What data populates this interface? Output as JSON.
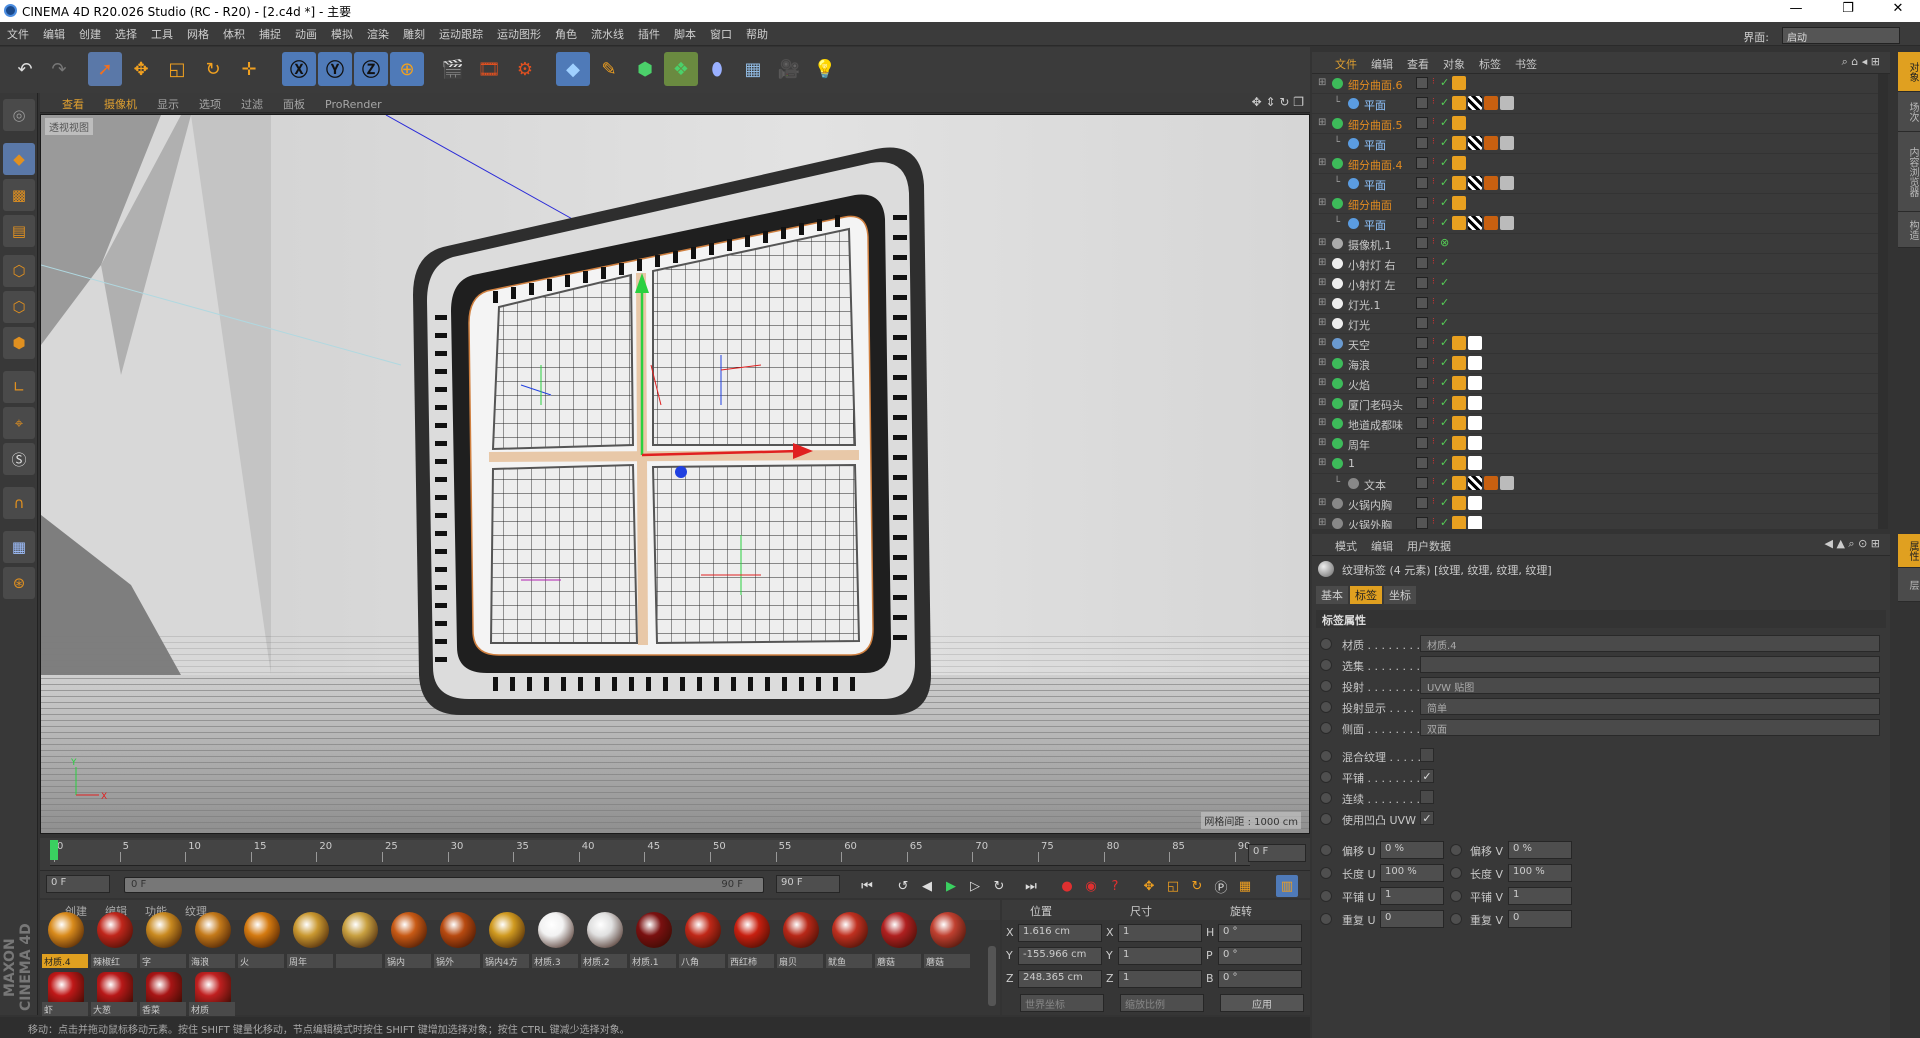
{
  "window": {
    "title": "CINEMA 4D R20.026 Studio (RC - R20) - [2.c4d *] - 主要"
  },
  "menu": [
    "文件",
    "编辑",
    "创建",
    "选择",
    "工具",
    "网格",
    "体积",
    "捕捉",
    "动画",
    "模拟",
    "渲染",
    "雕刻",
    "运动跟踪",
    "运动图形",
    "角色",
    "流水线",
    "插件",
    "脚本",
    "窗口",
    "帮助"
  ],
  "interface": {
    "label": "界面:",
    "value": "启动"
  },
  "viewport": {
    "menu": [
      "查看",
      "摄像机",
      "显示",
      "选项",
      "过滤",
      "面板",
      "ProRender"
    ],
    "name": "透视视图",
    "grid_spacing": "网格间距 : 1000 cm"
  },
  "timeline": {
    "ticks": [
      "0",
      "5",
      "10",
      "15",
      "20",
      "25",
      "30",
      "35",
      "40",
      "45",
      "50",
      "55",
      "60",
      "65",
      "70",
      "75",
      "80",
      "85",
      "90"
    ],
    "current_frame": "0 F",
    "start": "0 F",
    "range_start": "0 F",
    "range_end": "90 F",
    "end": "90 F"
  },
  "materials": {
    "menu": [
      "创建",
      "编辑",
      "功能",
      "纹理"
    ],
    "row1": [
      {
        "name": "材质.4",
        "color": "#d98b1c"
      },
      {
        "name": "辣椒红",
        "color": "#c0261b"
      },
      {
        "name": "字",
        "color": "#c98a20"
      },
      {
        "name": "海浪",
        "color": "#c47a1a"
      },
      {
        "name": "火",
        "color": "#d47a10"
      },
      {
        "name": "周年",
        "color": "#c99830"
      },
      {
        "name": "",
        "color": "#c8a040"
      },
      {
        "name": "锅内",
        "color": "#c85a15"
      },
      {
        "name": "锅外",
        "color": "#b84a10"
      },
      {
        "name": "锅内4方",
        "color": "#d09a20"
      },
      {
        "name": "材质.3",
        "color": "#f2f2f2"
      },
      {
        "name": "材质.2",
        "color": "#e0e0e0"
      },
      {
        "name": "材质.1",
        "color": "#7a1010"
      },
      {
        "name": "八角",
        "color": "#c02818"
      },
      {
        "name": "西红柿",
        "color": "#c82010"
      },
      {
        "name": "扇贝",
        "color": "#b82818"
      },
      {
        "name": "鱿鱼",
        "color": "#c03020"
      },
      {
        "name": "蘑菇",
        "color": "#b02020"
      },
      {
        "name": "蘑菇",
        "color": "#c04030"
      }
    ],
    "row2": [
      {
        "name": "虾",
        "color": "#c01818"
      },
      {
        "name": "大葱",
        "color": "#b81818"
      },
      {
        "name": "香菜",
        "color": "#a81515"
      },
      {
        "name": "材质",
        "color": "#c02020"
      }
    ]
  },
  "coords": {
    "headers": [
      "位置",
      "尺寸",
      "旋转"
    ],
    "rows": [
      {
        "axis": "X",
        "pos": "1.616 cm",
        "size_axis": "X",
        "size": "1",
        "rot_axis": "H",
        "rot": "0 °"
      },
      {
        "axis": "Y",
        "pos": "-155.966 cm",
        "size_axis": "Y",
        "size": "1",
        "rot_axis": "P",
        "rot": "0 °"
      },
      {
        "axis": "Z",
        "pos": "248.365 cm",
        "size_axis": "Z",
        "size": "1",
        "rot_axis": "B",
        "rot": "0 °"
      }
    ],
    "mode1": "世界坐标",
    "mode2": "缩放比例",
    "apply": "应用"
  },
  "status": "移动：点击并拖动鼠标移动元素。按住 SHIFT 键量化移动，节点编辑模式时按住 SHIFT 键增加选择对象；按住 CTRL 键减少选择对象。",
  "brand": "MAXON CINEMA 4D",
  "objects": {
    "menu": [
      "文件",
      "编辑",
      "查看",
      "对象",
      "标签",
      "书签"
    ],
    "rows": [
      {
        "name": "细分曲面.6",
        "indent": 1,
        "color": "#e08a20",
        "icon": "#3dbb5a"
      },
      {
        "name": "平面",
        "indent": 2,
        "color": "#8fc4ff",
        "icon": "#5b9ce0"
      },
      {
        "name": "细分曲面.5",
        "indent": 1,
        "color": "#e08a20",
        "icon": "#3dbb5a"
      },
      {
        "name": "平面",
        "indent": 2,
        "color": "#8fc4ff",
        "icon": "#5b9ce0"
      },
      {
        "name": "细分曲面.4",
        "indent": 1,
        "color": "#e08a20",
        "icon": "#3dbb5a"
      },
      {
        "name": "平面",
        "indent": 2,
        "color": "#8fc4ff",
        "icon": "#5b9ce0"
      },
      {
        "name": "细分曲面",
        "indent": 1,
        "color": "#e08a20",
        "icon": "#3dbb5a"
      },
      {
        "name": "平面",
        "indent": 2,
        "color": "#8fc4ff",
        "icon": "#5b9ce0"
      },
      {
        "name": "摄像机.1",
        "indent": 1,
        "color": "#c8c8c8",
        "icon": "#aaaaaa"
      },
      {
        "name": "小射灯 右",
        "indent": 1,
        "color": "#c8c8c8",
        "icon": "#eeeeee"
      },
      {
        "name": "小射灯 左",
        "indent": 1,
        "color": "#c8c8c8",
        "icon": "#eeeeee"
      },
      {
        "name": "灯光.1",
        "indent": 1,
        "color": "#c8c8c8",
        "icon": "#eeeeee"
      },
      {
        "name": "灯光",
        "indent": 1,
        "color": "#c8c8c8",
        "icon": "#eeeeee"
      },
      {
        "name": "天空",
        "indent": 1,
        "color": "#c8c8c8",
        "icon": "#6a9ad0"
      },
      {
        "name": "海浪",
        "indent": 1,
        "color": "#c8c8c8",
        "icon": "#3dbb5a"
      },
      {
        "name": "火焰",
        "indent": 1,
        "color": "#c8c8c8",
        "icon": "#3dbb5a"
      },
      {
        "name": "厦门老码头",
        "indent": 1,
        "color": "#c8c8c8",
        "icon": "#3dbb5a"
      },
      {
        "name": "地道成都味",
        "indent": 1,
        "color": "#c8c8c8",
        "icon": "#3dbb5a"
      },
      {
        "name": "周年",
        "indent": 1,
        "color": "#c8c8c8",
        "icon": "#3dbb5a"
      },
      {
        "name": "1",
        "indent": 1,
        "color": "#c8c8c8",
        "icon": "#3dbb5a"
      },
      {
        "name": "文本",
        "indent": 2,
        "color": "#c8c8c8",
        "icon": "#888888"
      },
      {
        "name": "火锅内胸",
        "indent": 1,
        "color": "#c8c8c8",
        "icon": "#888888"
      },
      {
        "name": "火锅外胸",
        "indent": 1,
        "color": "#c8c8c8",
        "icon": "#888888"
      }
    ]
  },
  "attributes": {
    "menu": [
      "模式",
      "编辑",
      "用户数据"
    ],
    "title": "纹理标签 (4 元素) [纹理, 纹理, 纹理, 纹理]",
    "tabs": [
      "基本",
      "标签",
      "坐标"
    ],
    "section": "标签属性",
    "fields": [
      {
        "label": "材质 . . . . . . . .",
        "value": "材质.4"
      },
      {
        "label": "选集 . . . . . . . .",
        "value": ""
      },
      {
        "label": "投射 . . . . . . . .",
        "value": "UVW 贴图"
      },
      {
        "label": "投射显示 . . . .",
        "value": "简单"
      },
      {
        "label": "侧面 . . . . . . . .",
        "value": "双面"
      }
    ],
    "checks": [
      {
        "label": "混合纹理 . . . . .",
        "value": ""
      },
      {
        "label": "平铺 . . . . . . . .",
        "value": "✓"
      },
      {
        "label": "连续 . . . . . . . .",
        "value": ""
      },
      {
        "label": "使用凹凸 UVW",
        "value": "✓"
      }
    ],
    "uv": [
      {
        "l1": "偏移 U",
        "v1": "0 %",
        "l2": "偏移 V",
        "v2": "0 %"
      },
      {
        "l1": "长度 U",
        "v1": "100 %",
        "l2": "长度 V",
        "v2": "100 %"
      },
      {
        "l1": "平铺 U",
        "v1": "1",
        "l2": "平铺 V",
        "v2": "1"
      },
      {
        "l1": "重复 U",
        "v1": "0",
        "l2": "重复 V",
        "v2": "0"
      }
    ]
  },
  "side_tabs": [
    "对象",
    "场次",
    "内容浏览器",
    "构造"
  ],
  "side_tabs2": [
    "属性",
    "层"
  ]
}
